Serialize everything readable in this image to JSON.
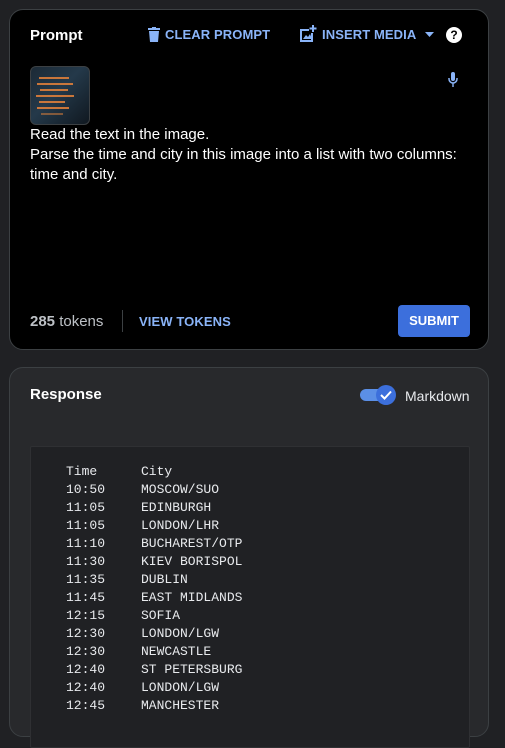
{
  "prompt": {
    "title": "Prompt",
    "clear_label": "CLEAR PROMPT",
    "insert_label": "INSERT MEDIA",
    "help_label": "?",
    "text_lines": [
      "Read the text in the image.",
      "Parse the time and city in this image into a list with two columns: time and city."
    ],
    "token_count": "285",
    "token_unit": "tokens",
    "view_tokens_label": "VIEW TOKENS",
    "submit_label": "SUBMIT"
  },
  "response": {
    "title": "Response",
    "markdown_label": "Markdown",
    "markdown_enabled": true,
    "table": {
      "header": [
        "Time",
        "City"
      ],
      "rows": [
        [
          "10:50",
          "MOSCOW/SUO"
        ],
        [
          "11:05",
          "EDINBURGH"
        ],
        [
          "11:05",
          "LONDON/LHR"
        ],
        [
          "11:10",
          "BUCHAREST/OTP"
        ],
        [
          "11:30",
          "KIEV BORISPOL"
        ],
        [
          "11:35",
          "DUBLIN"
        ],
        [
          "11:45",
          "EAST MIDLANDS"
        ],
        [
          "12:15",
          "SOFIA"
        ],
        [
          "12:30",
          "LONDON/LGW"
        ],
        [
          "12:30",
          "NEWCASTLE"
        ],
        [
          "12:40",
          "ST PETERSBURG"
        ],
        [
          "12:40",
          "LONDON/LGW"
        ],
        [
          "12:45",
          "MANCHESTER"
        ]
      ]
    }
  },
  "colors": {
    "accent": "#8ab4f8",
    "submit": "#3c6fdc",
    "background": "#202124"
  }
}
